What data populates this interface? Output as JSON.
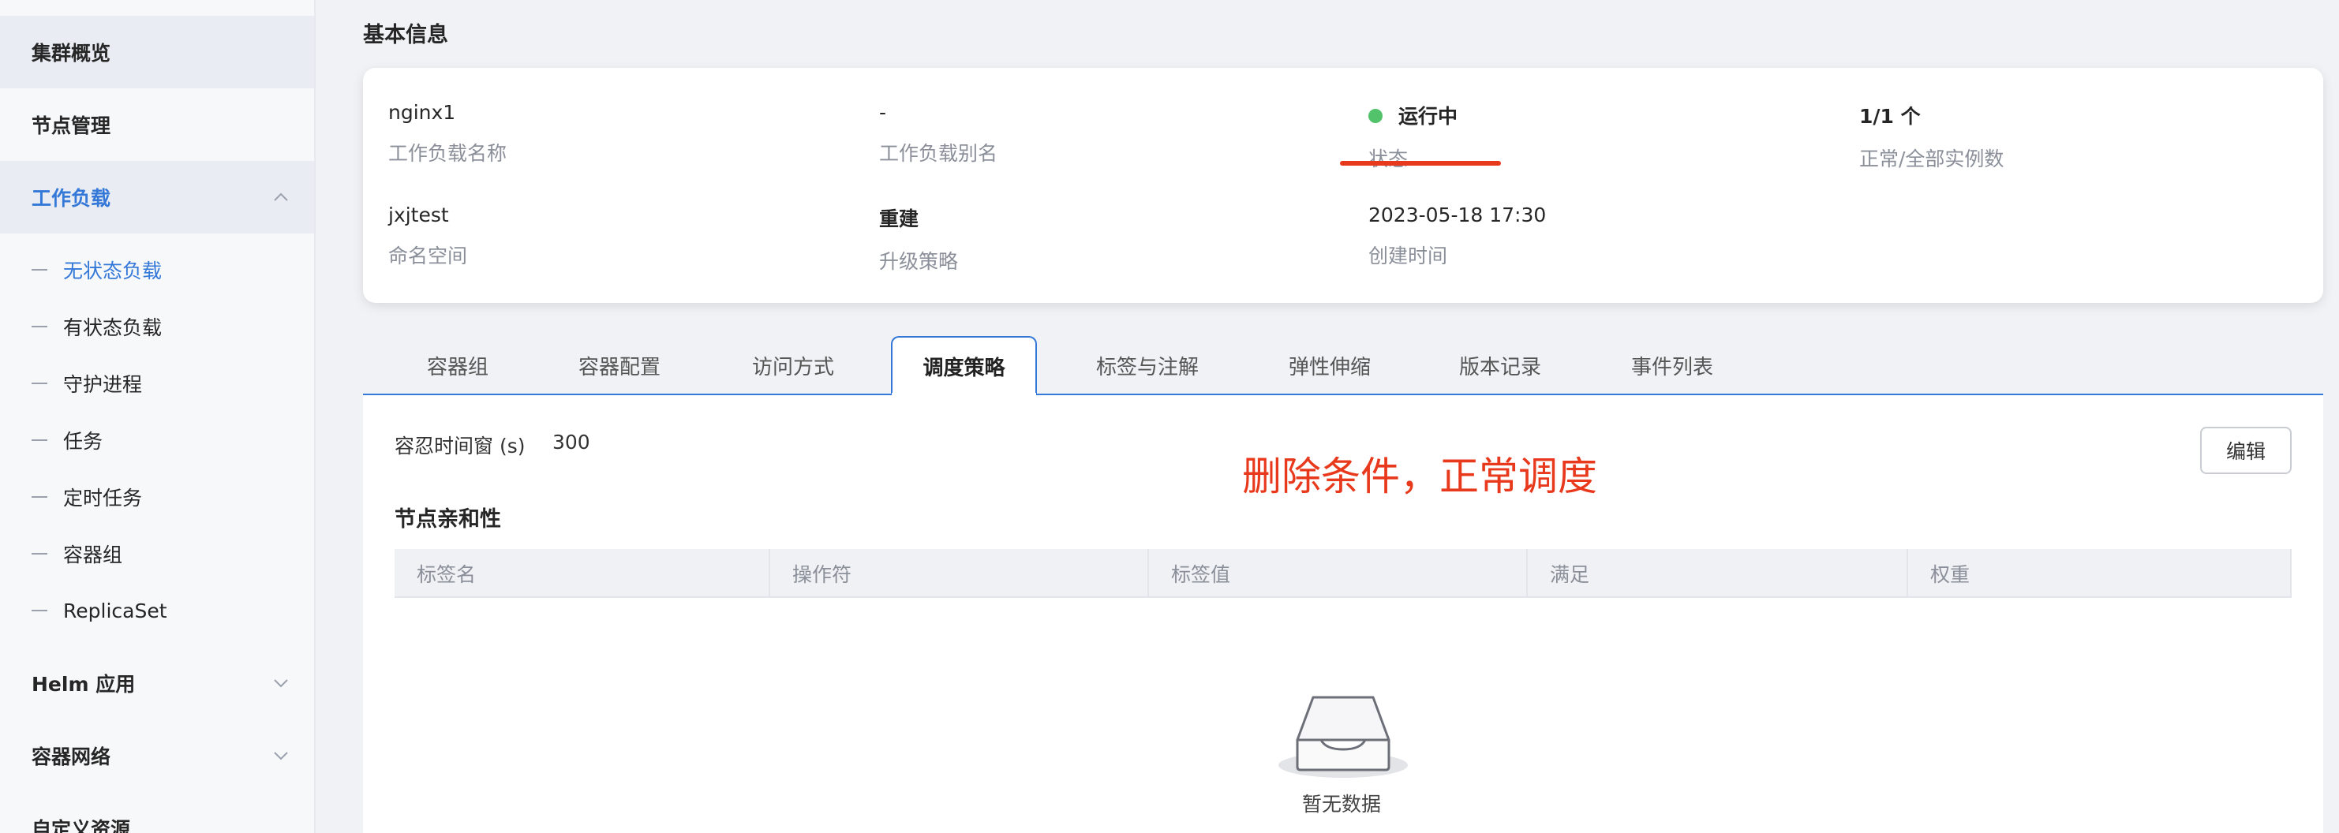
{
  "sidebar": {
    "items": [
      {
        "label": "集群概览"
      },
      {
        "label": "节点管理"
      },
      {
        "label": "工作负载"
      },
      {
        "label": "Helm 应用"
      },
      {
        "label": "容器网络"
      },
      {
        "label": "自定义资源"
      }
    ],
    "workload_sub": [
      {
        "label": "无状态负载"
      },
      {
        "label": "有状态负载"
      },
      {
        "label": "守护进程"
      },
      {
        "label": "任务"
      },
      {
        "label": "定时任务"
      },
      {
        "label": "容器组"
      },
      {
        "label": "ReplicaSet"
      }
    ]
  },
  "basic_info": {
    "title": "基本信息",
    "workload_name": {
      "value": "nginx1",
      "label": "工作负载名称"
    },
    "workload_alias": {
      "value": "-",
      "label": "工作负载别名"
    },
    "status": {
      "value": "运行中",
      "label": "状态",
      "color": "#52c26b"
    },
    "instances": {
      "value": "1/1 个",
      "label": "正常/全部实例数"
    },
    "namespace": {
      "value": "jxjtest",
      "label": "命名空间"
    },
    "upgrade_strategy": {
      "value": "重建",
      "label": "升级策略"
    },
    "created_time": {
      "value": "2023-05-18 17:30",
      "label": "创建时间"
    }
  },
  "tabs": [
    {
      "label": "容器组"
    },
    {
      "label": "容器配置"
    },
    {
      "label": "访问方式"
    },
    {
      "label": "调度策略"
    },
    {
      "label": "标签与注解"
    },
    {
      "label": "弹性伸缩"
    },
    {
      "label": "版本记录"
    },
    {
      "label": "事件列表"
    }
  ],
  "active_tab": "调度策略",
  "scheduling": {
    "toleration_label": "容忍时间窗 (s)",
    "toleration_value": "300",
    "edit_label": "编辑",
    "annotation": "删除条件，正常调度",
    "affinity_title": "节点亲和性",
    "columns": [
      "标签名",
      "操作符",
      "标签值",
      "满足",
      "权重"
    ],
    "empty_text": "暂无数据"
  },
  "colors": {
    "accent": "#3478d8",
    "annotation_red": "#e8391c",
    "status_green": "#52c26b"
  }
}
